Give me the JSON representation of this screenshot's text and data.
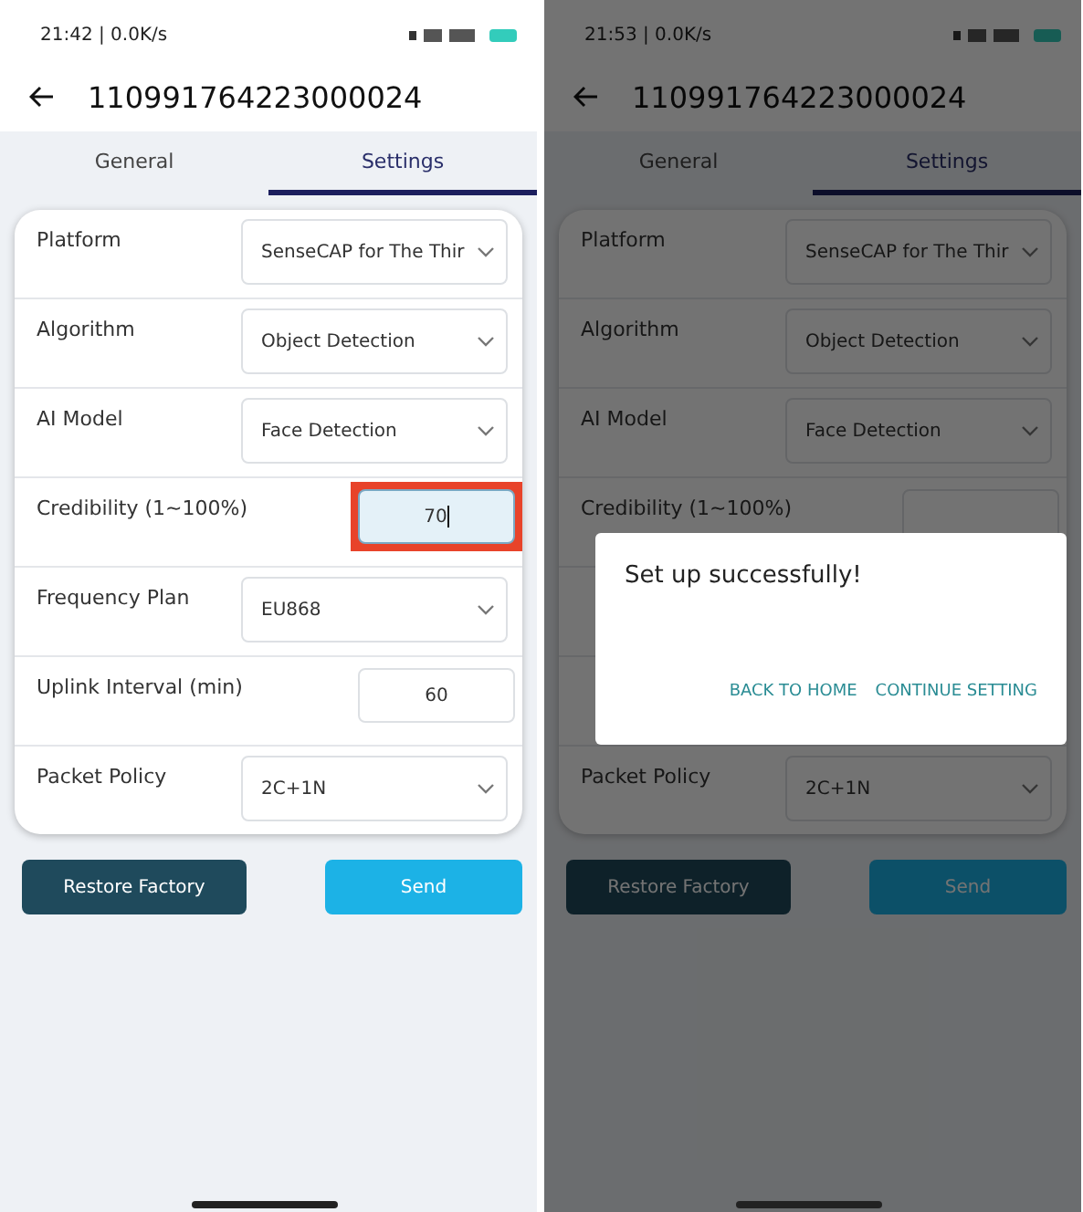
{
  "screens": [
    {
      "status_bar": {
        "time": "21:42 | 0.0K/s"
      },
      "title": "110991764223000024",
      "tabs": [
        {
          "label": "General",
          "selected": false
        },
        {
          "label": "Settings",
          "selected": true
        }
      ],
      "settings": [
        {
          "kind": "select",
          "label": "Platform",
          "value": "SenseCAP for The Thir"
        },
        {
          "kind": "select",
          "label": "Algorithm",
          "value": "Object Detection"
        },
        {
          "kind": "select",
          "label": "AI Model",
          "value": "Face Detection"
        },
        {
          "kind": "input",
          "label": "Credibility (1~100%)",
          "value": "70",
          "focused": true,
          "highlighted": true
        },
        {
          "kind": "select",
          "label": "Frequency Plan",
          "value": "EU868"
        },
        {
          "kind": "input",
          "label": "Uplink Interval (min)",
          "value": "60",
          "focused": false,
          "highlighted": false
        },
        {
          "kind": "select",
          "label": "Packet Policy",
          "value": "2C+1N"
        }
      ],
      "buttons": [
        {
          "kind": "secondary",
          "label": "Restore Factory"
        },
        {
          "kind": "primary",
          "label": "Send"
        }
      ],
      "dimmed": false
    },
    {
      "status_bar": {
        "time": "21:53 | 0.0K/s"
      },
      "title": "110991764223000024",
      "tabs": [
        {
          "label": "General",
          "selected": false
        },
        {
          "label": "Settings",
          "selected": true
        }
      ],
      "settings": [
        {
          "kind": "select",
          "label": "Platform",
          "value": "SenseCAP for The Thir"
        },
        {
          "kind": "select",
          "label": "Algorithm",
          "value": "Object Detection"
        },
        {
          "kind": "select",
          "label": "AI Model",
          "value": "Face Detection"
        },
        {
          "kind": "input",
          "label": "Credibility (1~100%)",
          "focused": false,
          "highlighted": false
        },
        {
          "kind": "hidden"
        },
        {
          "kind": "hidden"
        },
        {
          "kind": "select",
          "label": "Packet Policy",
          "value": "2C+1N"
        }
      ],
      "buttons": [
        {
          "kind": "secondary",
          "label": "Restore Factory"
        },
        {
          "kind": "primary",
          "label": "Send"
        }
      ],
      "dimmed": true,
      "dialog": {
        "message": "Set up successfully!",
        "actions": [
          "BACK TO HOME",
          "CONTINUE SETTING"
        ]
      }
    }
  ]
}
